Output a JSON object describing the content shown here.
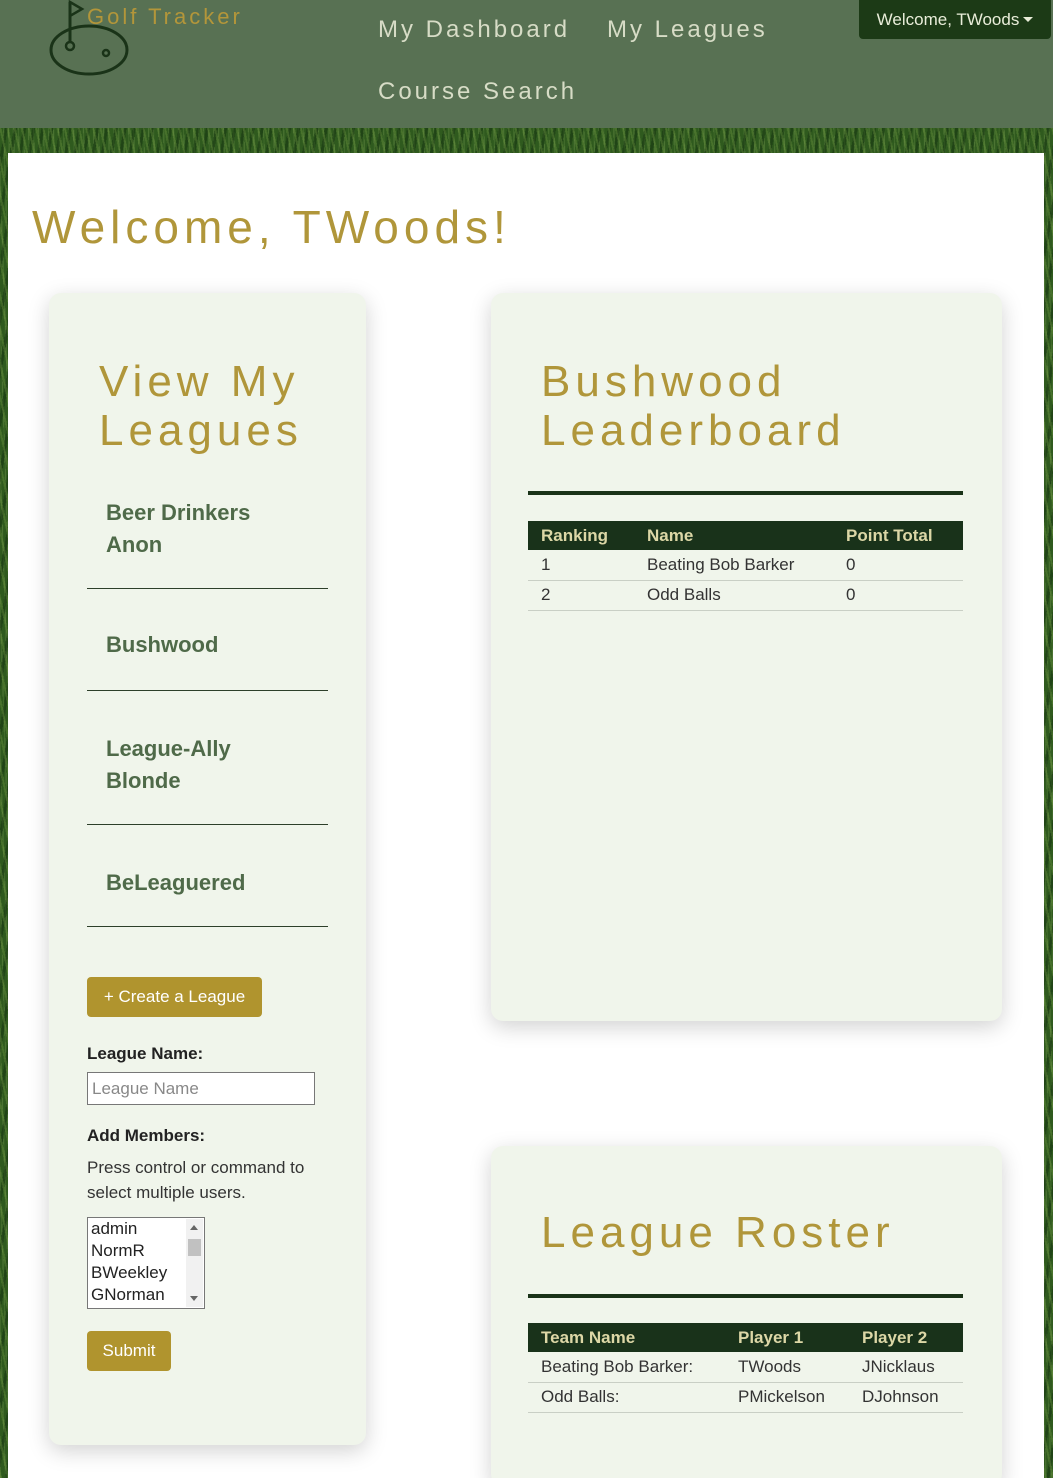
{
  "navbar": {
    "brand": "Golf Tracker",
    "links": [
      "My Dashboard",
      "My Leagues",
      "Course Search"
    ],
    "user_menu": "Welcome, TWoods"
  },
  "page": {
    "welcome": "Welcome, TWoods!"
  },
  "leagues_card": {
    "title": "View My Leagues",
    "items": [
      "Beer Drinkers Anon",
      "Bushwood",
      "League-Ally Blonde",
      "BeLeaguered"
    ],
    "create_button": "+ Create a League",
    "form": {
      "league_name_label": "League Name:",
      "league_name_placeholder": "League Name",
      "league_name_value": "",
      "members_label": "Add Members:",
      "members_help": "Press control or command to select multiple users.",
      "members_options": [
        "admin",
        "NormR",
        "BWeekley",
        "GNorman"
      ],
      "submit_button": "Submit"
    }
  },
  "leaderboard": {
    "title": "Bushwood Leaderboard",
    "columns": [
      "Ranking",
      "Name",
      "Point Total"
    ],
    "rows": [
      [
        "1",
        "Beating Bob Barker",
        "0"
      ],
      [
        "2",
        "Odd Balls",
        "0"
      ]
    ]
  },
  "roster": {
    "title": "League Roster",
    "columns": [
      "Team Name",
      "Player 1",
      "Player 2"
    ],
    "rows": [
      [
        "Beating Bob Barker:",
        "TWoods",
        "JNicklaus"
      ],
      [
        "Odd Balls:",
        "PMickelson",
        "DJohnson"
      ]
    ]
  },
  "colors": {
    "navbar_bg": "#587153",
    "accent_gold": "#b0963a",
    "dark_green": "#19321a",
    "card_bg": "#f0f5eb"
  }
}
